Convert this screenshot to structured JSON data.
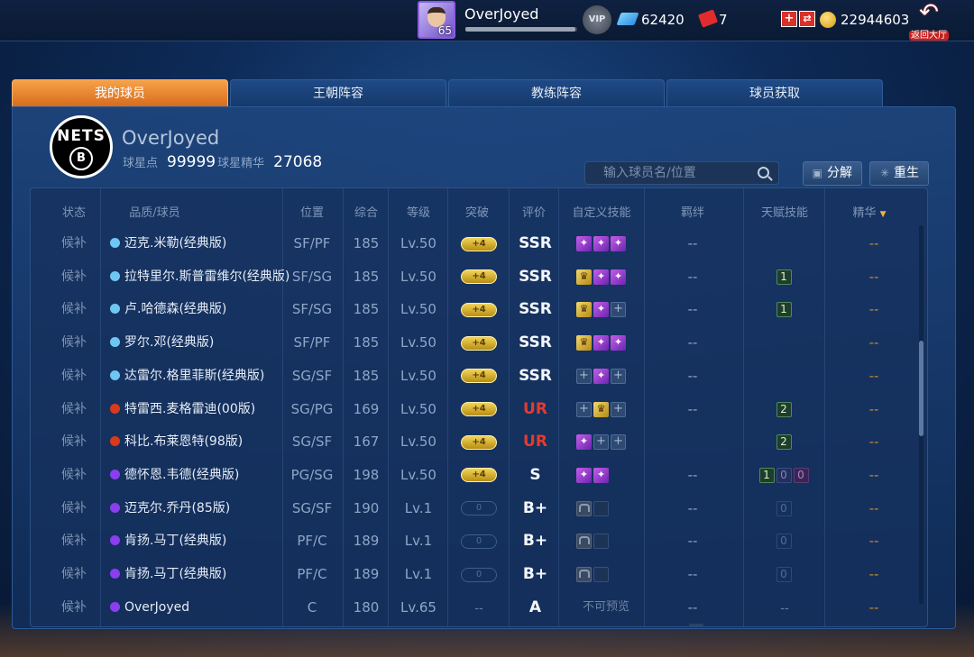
{
  "colors": {
    "accent_tab": "#e8832e",
    "gold_break": "#e3c046",
    "ur_red": "#e83a2b",
    "blue_dot": "#6ec6f2",
    "red_dot": "#d93a1c",
    "purple_dot": "#8a3ef0"
  },
  "topbar": {
    "player_level": "65",
    "username": "OverJoyed",
    "exp_progress": 0.98,
    "vip_label": "VIP",
    "gems": "62420",
    "tickets": "7",
    "coins": "22944603",
    "plus_label": "+",
    "exchange_label": "⇄",
    "back_label": "返回大厅",
    "icons": [
      "avatar",
      "vip-badge-icon",
      "diamond-icon",
      "ticket-icon",
      "add-icon",
      "exchange-icon",
      "coin-icon",
      "back-arrow-icon"
    ]
  },
  "tabs": [
    {
      "label": "我的球员",
      "active": true
    },
    {
      "label": "王朝阵容",
      "active": false
    },
    {
      "label": "教练阵容",
      "active": false
    },
    {
      "label": "球员获取",
      "active": false
    }
  ],
  "team": {
    "logo_text": "NETS",
    "logo_letter": "B",
    "name": "OverJoyed",
    "star_points_label": "球星点",
    "star_points": "99999",
    "essence_label": "球星精华",
    "essence": "27068"
  },
  "search": {
    "placeholder": "输入球员名/位置"
  },
  "actions": {
    "decompose_label": "分解",
    "rebirth_label": "重生"
  },
  "table": {
    "headers": [
      "状态",
      "品质/球员",
      "位置",
      "综合",
      "等级",
      "突破",
      "评价",
      "自定义技能",
      "羁绊",
      "天赋技能",
      "精华"
    ],
    "sort_indicator": "▼",
    "rows": [
      {
        "status": "候补",
        "quality": "blue",
        "name": "迈克.米勒(经典版)",
        "pos": "SF/PF",
        "ovr": "185",
        "level": "Lv.50",
        "breakthrough": "+4",
        "break_on": true,
        "grade": "SSR",
        "skills": [
          "purple",
          "purple",
          "purple"
        ],
        "bond": "--",
        "talent": [],
        "essence": "--"
      },
      {
        "status": "候补",
        "quality": "blue",
        "name": "拉特里尔.斯普雷维尔(经典版)",
        "pos": "SF/SG",
        "ovr": "185",
        "level": "Lv.50",
        "breakthrough": "+4",
        "break_on": true,
        "grade": "SSR",
        "skills": [
          "gold",
          "purple",
          "purple"
        ],
        "bond": "--",
        "talent": [
          "1"
        ],
        "essence": "--"
      },
      {
        "status": "候补",
        "quality": "blue",
        "name": "卢.哈德森(经典版)",
        "pos": "SF/SG",
        "ovr": "185",
        "level": "Lv.50",
        "breakthrough": "+4",
        "break_on": true,
        "grade": "SSR",
        "skills": [
          "gold",
          "purple",
          "empty"
        ],
        "bond": "--",
        "talent": [
          "1"
        ],
        "essence": "--"
      },
      {
        "status": "候补",
        "quality": "blue",
        "name": "罗尔.邓(经典版)",
        "pos": "SF/PF",
        "ovr": "185",
        "level": "Lv.50",
        "breakthrough": "+4",
        "break_on": true,
        "grade": "SSR",
        "skills": [
          "gold",
          "purple",
          "purple"
        ],
        "bond": "--",
        "talent": [],
        "essence": "--"
      },
      {
        "status": "候补",
        "quality": "blue",
        "name": "达雷尔.格里菲斯(经典版)",
        "pos": "SG/SF",
        "ovr": "185",
        "level": "Lv.50",
        "breakthrough": "+4",
        "break_on": true,
        "grade": "SSR",
        "skills": [
          "empty",
          "purple",
          "empty"
        ],
        "bond": "--",
        "talent": [],
        "essence": "--"
      },
      {
        "status": "候补",
        "quality": "red",
        "name": "特雷西.麦格雷迪(00版)",
        "pos": "SG/PG",
        "ovr": "169",
        "level": "Lv.50",
        "breakthrough": "+4",
        "break_on": true,
        "grade": "UR",
        "skills": [
          "empty",
          "gold",
          "empty"
        ],
        "bond": "--",
        "talent": [
          "2"
        ],
        "essence": "--"
      },
      {
        "status": "候补",
        "quality": "red",
        "name": "科比.布莱恩特(98版)",
        "pos": "SG/SF",
        "ovr": "167",
        "level": "Lv.50",
        "breakthrough": "+4",
        "break_on": true,
        "grade": "UR",
        "skills": [
          "purple",
          "empty",
          "empty"
        ],
        "bond": "",
        "talent": [
          "2"
        ],
        "essence": "--"
      },
      {
        "status": "候补",
        "quality": "purple",
        "name": "德怀恩.韦德(经典版)",
        "pos": "PG/SG",
        "ovr": "198",
        "level": "Lv.50",
        "breakthrough": "+4",
        "break_on": true,
        "grade": "S",
        "skills": [
          "purple",
          "purple"
        ],
        "bond": "--",
        "talent": [
          "1",
          "0",
          "0"
        ],
        "essence": "--"
      },
      {
        "status": "候补",
        "quality": "purple",
        "name": "迈克尔.乔丹(85版)",
        "pos": "SG/SF",
        "ovr": "190",
        "level": "Lv.1",
        "breakthrough": "0",
        "break_on": false,
        "grade": "B+",
        "skills": [
          "lock",
          "dark"
        ],
        "bond": "--",
        "talent": [
          "0"
        ],
        "essence": "--"
      },
      {
        "status": "候补",
        "quality": "purple",
        "name": "肯扬.马丁(经典版)",
        "pos": "PF/C",
        "ovr": "189",
        "level": "Lv.1",
        "breakthrough": "0",
        "break_on": false,
        "grade": "B+",
        "skills": [
          "lock",
          "dark"
        ],
        "bond": "--",
        "talent": [
          "0"
        ],
        "essence": "--"
      },
      {
        "status": "候补",
        "quality": "purple",
        "name": "肯扬.马丁(经典版)",
        "pos": "PF/C",
        "ovr": "189",
        "level": "Lv.1",
        "breakthrough": "0",
        "break_on": false,
        "grade": "B+",
        "skills": [
          "lock",
          "dark"
        ],
        "bond": "--",
        "talent": [
          "0"
        ],
        "essence": "--"
      },
      {
        "status": "候补",
        "quality": "purple",
        "name": "OverJoyed",
        "pos": "C",
        "ovr": "180",
        "level": "Lv.65",
        "breakthrough": "--",
        "break_on": null,
        "grade": "A",
        "skills_text": "不可预览",
        "bond": "--",
        "talent_text": "--",
        "essence": "--"
      }
    ]
  }
}
